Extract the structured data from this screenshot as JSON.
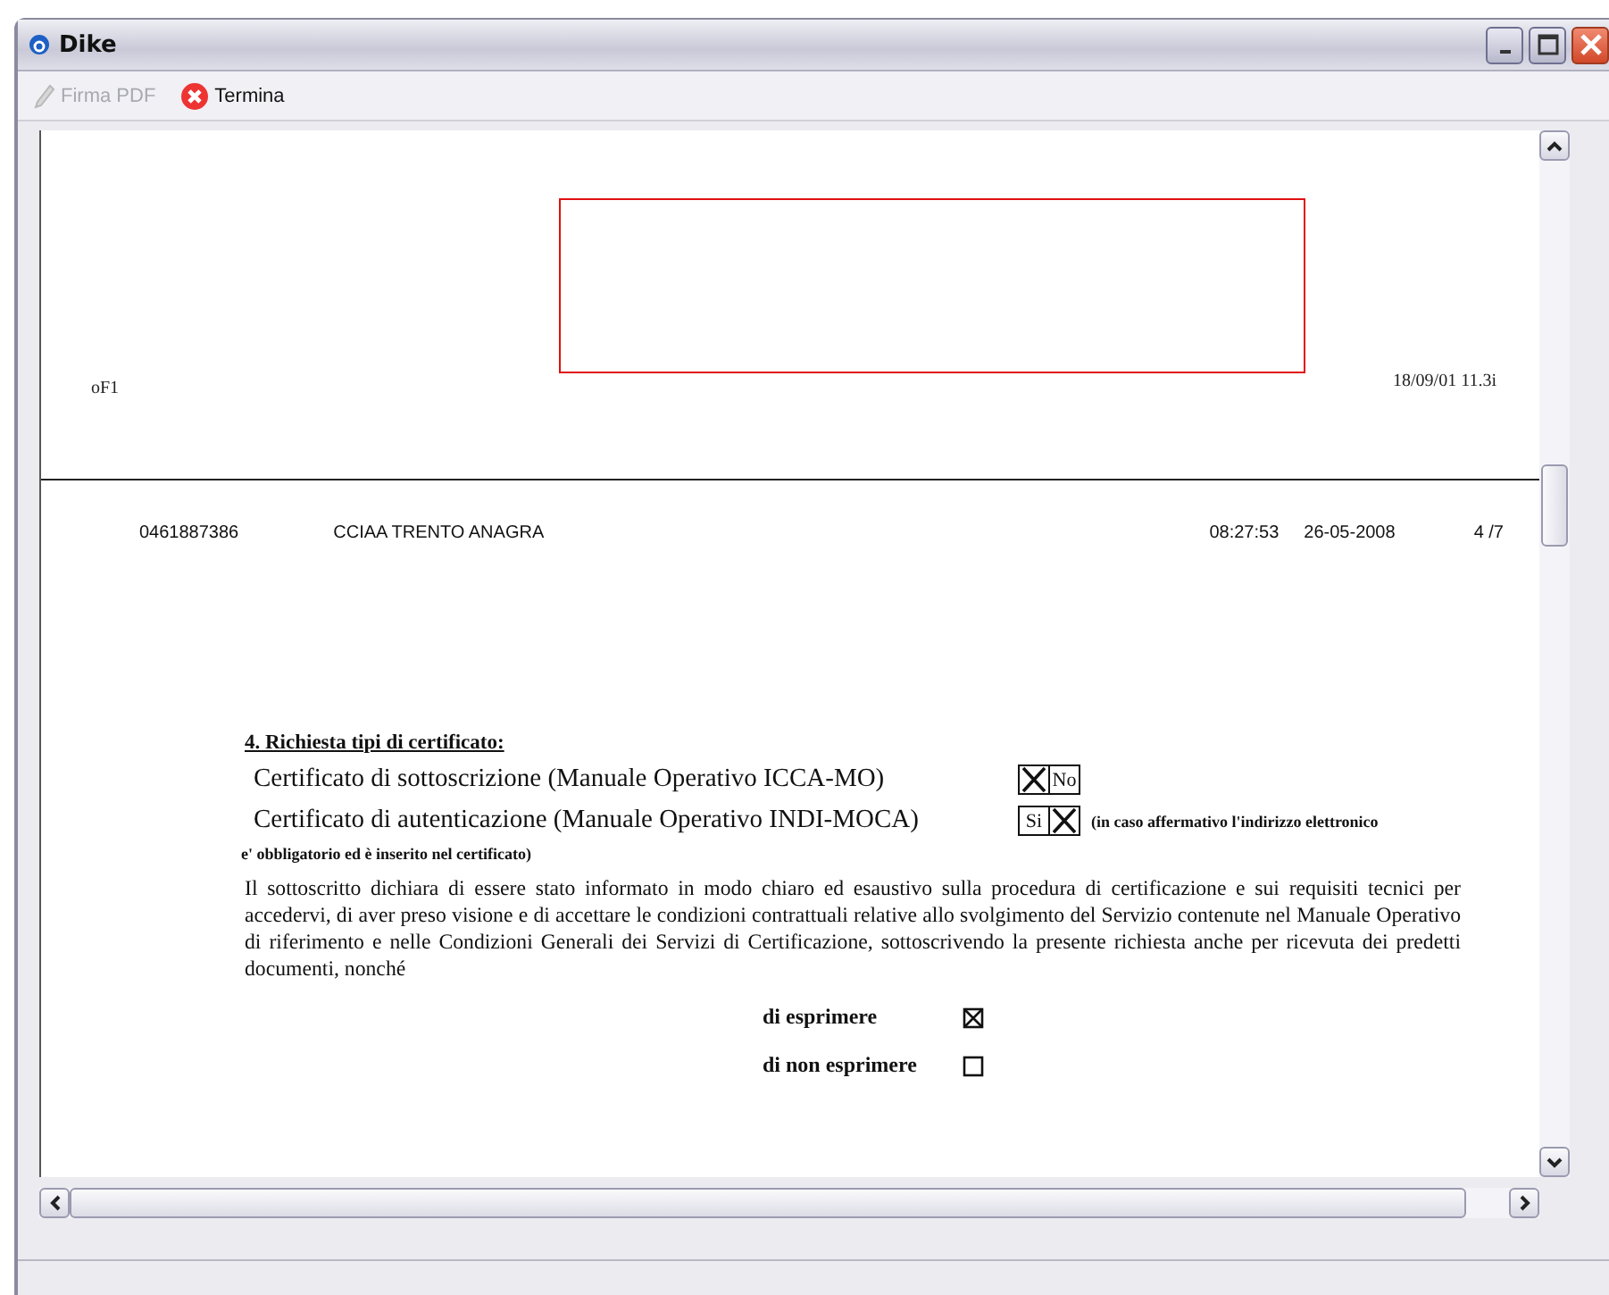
{
  "window": {
    "title": "Dike"
  },
  "toolbar": [
    {
      "label": "Firma PDF",
      "kind": "pen",
      "disabled": true
    },
    {
      "label": "Termina",
      "kind": "stop",
      "disabled": false
    }
  ],
  "previous_page": {
    "corner_mark": "oF1",
    "timestamp": "18/09/01 11.3i"
  },
  "page": {
    "header": [
      "0461887386",
      "CCIAA TRENTO ANAGRA",
      "08:27:53",
      "26-05-2008",
      "4 /7"
    ],
    "heading": "4. Richiesta tipi di certificato:",
    "certificates": [
      {
        "label": "Certificato di sottoscrizione (Manuale Operativo ICCA-MO)",
        "choices": [
          {
            "checked": true
          },
          {
            "label": "No",
            "checked": false
          }
        ]
      },
      {
        "label": "Certificato di autenticazione (Manuale Operativo INDI-MOCA)",
        "choices": [
          {
            "label": "Si",
            "checked": false
          },
          {
            "checked": true
          }
        ],
        "note": "(in caso affermativo l'indirizzo elettronico"
      }
    ],
    "note_continuation": "e' obbligatorio ed è inserito nel certificato)",
    "paragraph": "Il sottoscritto dichiara di essere stato informato in modo chiaro ed esaustivo sulla procedura di certificazione e sui requisiti tecnici per accedervi, di aver preso visione e di accettare le condizioni contrattuali relative allo svolgimento del Servizio contenute nel Manuale Operativo di riferimento e nelle Condizioni Generali dei Servizi di Certificazione, sottoscrivendo la presente richiesta anche per ricevuta dei predetti documenti, nonché",
    "consents": [
      {
        "label": "di esprimere",
        "checked": true
      },
      {
        "label": "di non esprimere",
        "checked": false
      }
    ]
  }
}
